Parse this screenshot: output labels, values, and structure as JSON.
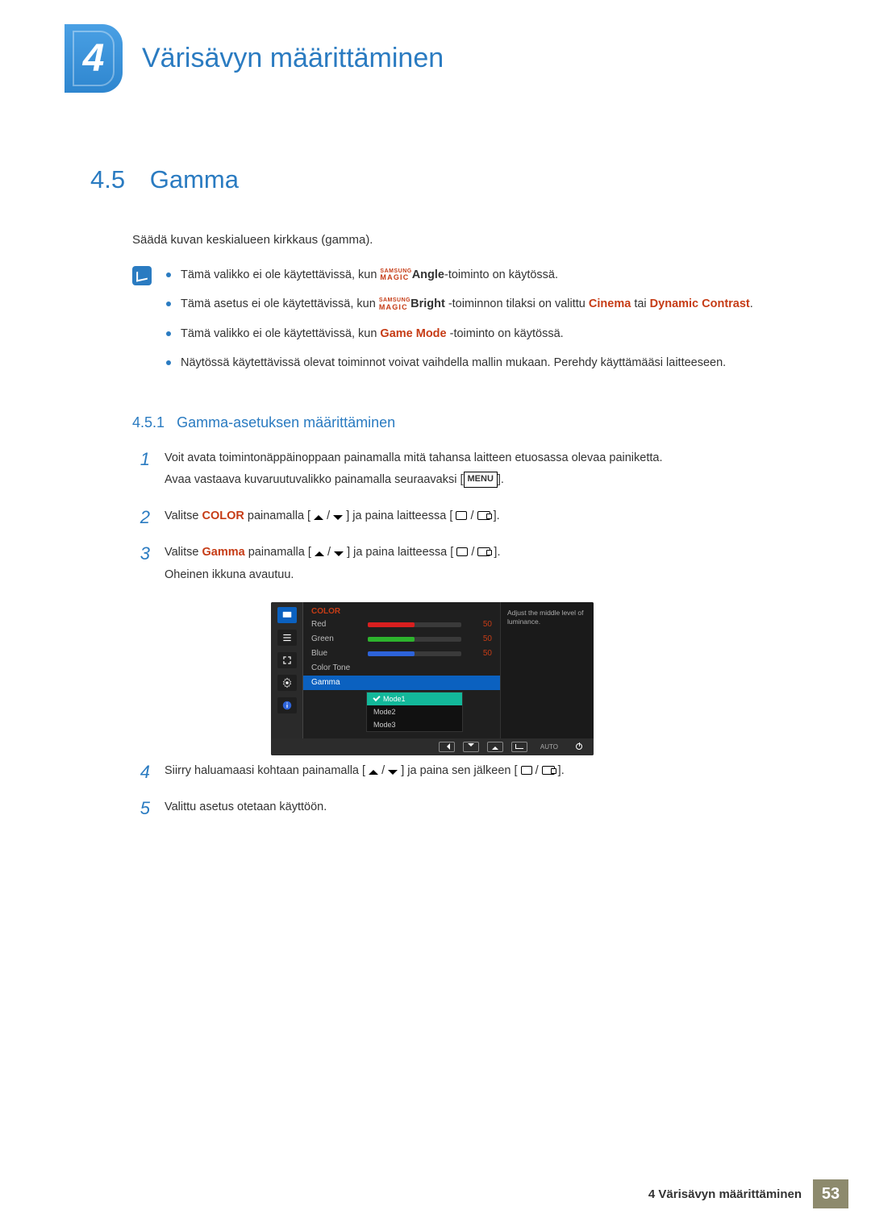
{
  "chapter": {
    "number": "4",
    "title": "Värisävyn määrittäminen"
  },
  "section": {
    "number": "4.5",
    "title": "Gamma"
  },
  "lead": "Säädä kuvan keskialueen kirkkaus (gamma).",
  "magic": {
    "sup": "SAMSUNG",
    "sub": "MAGIC"
  },
  "notes": {
    "n1": {
      "a": "Tämä valikko ei ole käytettävissä, kun ",
      "fn": "Angle",
      "b": "-toiminto on käytössä."
    },
    "n2": {
      "a": "Tämä asetus ei ole käytettävissä, kun ",
      "fn": "Bright",
      "b": " -toiminnon tilaksi on valittu ",
      "o1": "Cinema",
      "c": " tai ",
      "o2": "Dynamic Contrast",
      "d": "."
    },
    "n3": {
      "a": "Tämä valikko ei ole käytettävissä, kun ",
      "o": "Game Mode",
      "b": "-toiminto on käytössä."
    },
    "n4": "Näytössä käytettävissä olevat toiminnot voivat vaihdella mallin mukaan. Perehdy käyttämääsi laitteeseen."
  },
  "subsection": {
    "number": "4.5.1",
    "title": "Gamma-asetuksen määrittäminen"
  },
  "steps": {
    "s1": {
      "num": "1",
      "p1": "Voit avata toimintonäppäinoppaan painamalla mitä tahansa laitteen etuosassa olevaa painiketta.",
      "p2a": "Avaa vastaava kuvaruutuvalikko painamalla seuraavaksi [",
      "menu": "MENU",
      "p2b": "]."
    },
    "s2": {
      "num": "2",
      "a": "Valitse ",
      "o": "COLOR",
      "b": " painamalla [",
      "c": "] ja paina laitteessa [",
      "d": "]."
    },
    "s3": {
      "num": "3",
      "a": "Valitse ",
      "o": "Gamma",
      "b": " painamalla [",
      "c": "] ja paina laitteessa [",
      "d": "].",
      "p2": "Oheinen ikkuna avautuu."
    },
    "s4": {
      "num": "4",
      "a": "Siirry haluamaasi kohtaan painamalla [",
      "b": "] ja paina sen jälkeen [",
      "c": "]."
    },
    "s5": {
      "num": "5",
      "text": "Valittu asetus otetaan käyttöön."
    }
  },
  "osd": {
    "title": "COLOR",
    "rows": {
      "red": {
        "label": "Red",
        "value": "50",
        "pct": 50,
        "color": "#d91f1f"
      },
      "green": {
        "label": "Green",
        "value": "50",
        "pct": 50,
        "color": "#2db32d"
      },
      "blue": {
        "label": "Blue",
        "value": "50",
        "pct": 50,
        "color": "#2d63d9"
      }
    },
    "colorTone": "Color Tone",
    "gamma": "Gamma",
    "options": {
      "o1": "Mode1",
      "o2": "Mode2",
      "o3": "Mode3"
    },
    "hint": "Adjust the middle level of luminance.",
    "auto": "AUTO"
  },
  "footer": {
    "text": "4 Värisävyn määrittäminen",
    "page": "53"
  }
}
